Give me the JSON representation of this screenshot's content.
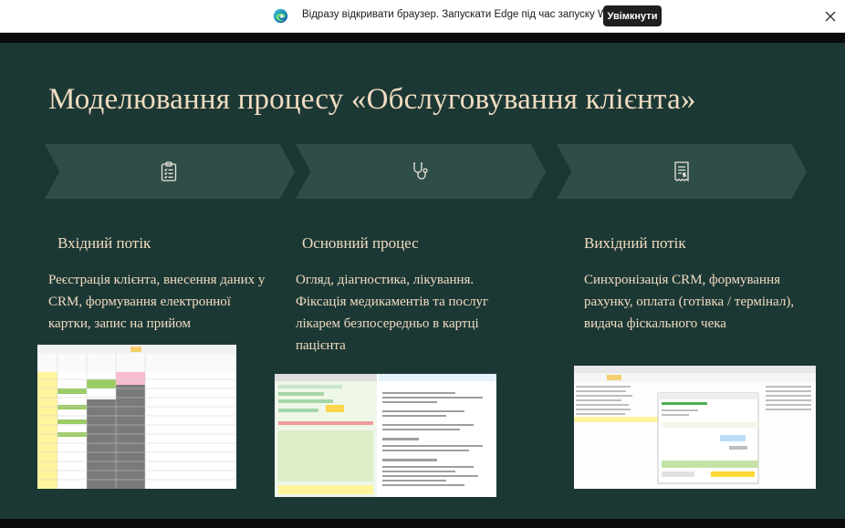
{
  "notification": {
    "message": "Відразу відкривати браузер. Запускати Edge під час запуску Windows.",
    "enable_label": "Увімкнути",
    "icons": {
      "logo": "edge-logo-icon",
      "close": "close-icon"
    }
  },
  "slide": {
    "title": "Моделювання процесу «Обслуговування клієнта»",
    "colors": {
      "background": "#1c3835",
      "chevron": "#2f4e49",
      "text": "#f1dcc1"
    },
    "columns": [
      {
        "icon": "clipboard-checklist-icon",
        "heading": "Вхідний потік",
        "body": "Реєстрація клієнта, внесення даних у CRM, формування електронної картки, запис на прийом"
      },
      {
        "icon": "stethoscope-icon",
        "heading": "Основний процес",
        "body": "Огляд, діагностика, лікування. Фіксація медикаментів та послуг лікарем безпосередньо в картці пацієнта"
      },
      {
        "icon": "receipt-icon",
        "heading": "Вихідний потік",
        "body": "Синхронізація CRM, формування рахунку, оплата (готівка / термінал), видача фіскального чека"
      }
    ]
  }
}
